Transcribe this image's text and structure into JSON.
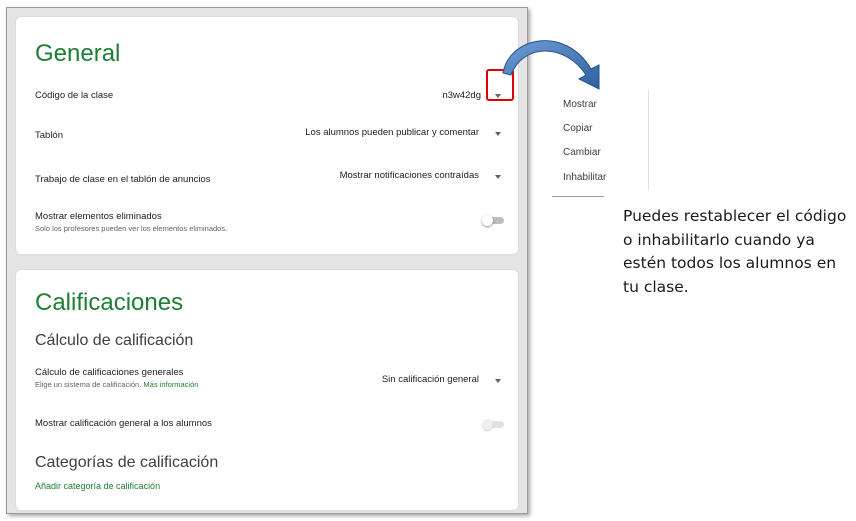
{
  "general": {
    "title": "General",
    "class_code_label": "Código de la clase",
    "class_code_value": "n3w42dg",
    "stream_label": "Tablón",
    "stream_value": "Los alumnos pueden publicar y comentar",
    "classwork_label": "Trabajo de clase en el tablón de anuncios",
    "classwork_value": "Mostrar notificaciones contraídas",
    "deleted_label": "Mostrar elementos eliminados",
    "deleted_sub": "Solo los profesores pueden ver los elementos eliminados."
  },
  "grades": {
    "title": "Calificaciones",
    "calc_heading": "Cálculo de calificación",
    "calc_label": "Cálculo de calificaciones generales",
    "calc_sub": "Elige un sistema de calificación.",
    "calc_link": "Más información",
    "calc_value": "Sin calificación general",
    "show_overall_label": "Mostrar calificación general a los alumnos",
    "categories_heading": "Categorías de calificación",
    "add_category": "Añadir categoría de calificación"
  },
  "menu": {
    "items": [
      "Mostrar",
      "Copiar",
      "Cambiar",
      "Inhabilitar"
    ]
  },
  "note": "Puedes restablecer el código o inhabilitarlo cuando ya estén todos los alumnos en tu clase.",
  "colors": {
    "accent_green": "#1e7e34",
    "highlight_red": "#e00000",
    "arrow_blue": "#4a7fc1"
  },
  "icons": {
    "dropdown": "caret-down-icon",
    "arrow": "curved-arrow-icon"
  }
}
